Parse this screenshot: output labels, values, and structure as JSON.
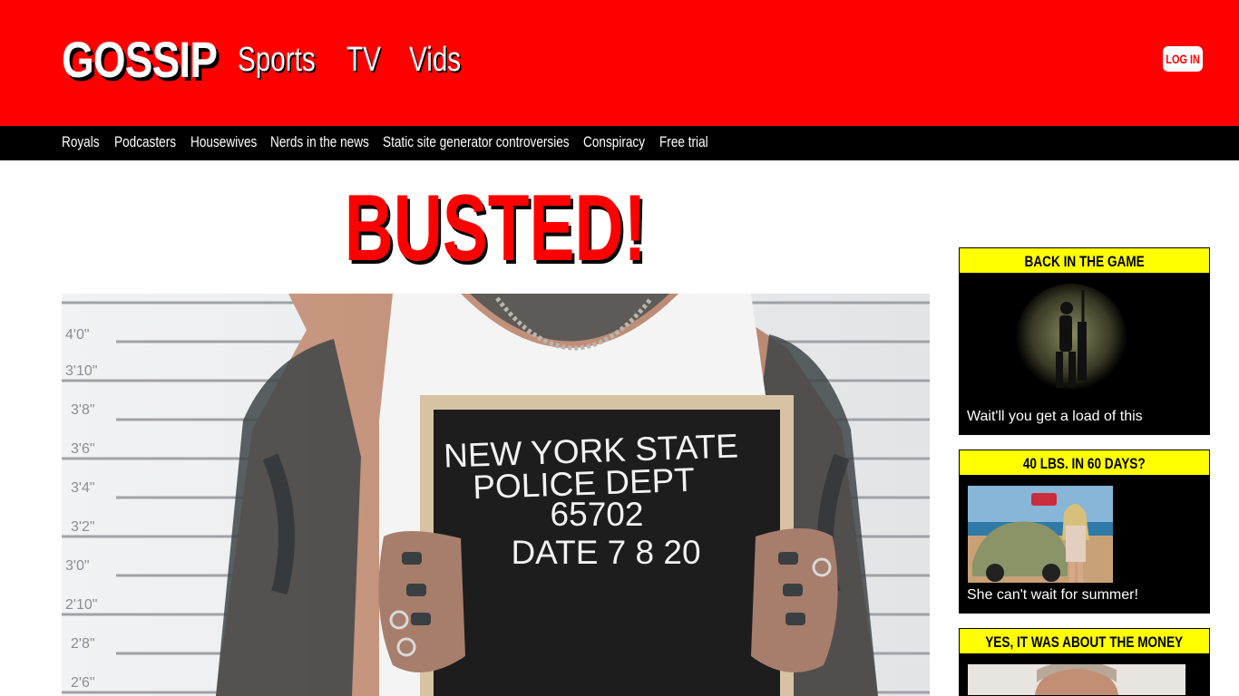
{
  "header": {
    "logo": "GOSSIP",
    "nav": [
      "Sports",
      "TV",
      "Vids"
    ],
    "login_label": "LOG IN"
  },
  "subnav": {
    "items": [
      "Royals",
      "Podcasters",
      "Housewives",
      "Nerds in the news",
      "Static site generator controversies",
      "Conspiracy",
      "Free trial"
    ]
  },
  "article": {
    "headline": "BUSTED!",
    "sign": {
      "line1": "NEW YORK STATE",
      "line2": "POLICE DEPT",
      "line3": "65702",
      "line4": "DATE 7 8 20"
    },
    "height_marks": [
      "4'0\"",
      "3'10\"",
      "3'8\"",
      "3'6\"",
      "3'4\"",
      "3'2\"",
      "3'0\"",
      "2'10\"",
      "2'8\"",
      "2'6\""
    ]
  },
  "sidebar": {
    "cards": [
      {
        "title": "BACK IN THE GAME",
        "caption": "Wait'll you get a load of this"
      },
      {
        "title": "40 LBS. IN 60 DAYS?",
        "caption": "She can't wait for summer!"
      },
      {
        "title": "YES, IT WAS ABOUT THE MONEY",
        "caption": ""
      }
    ]
  },
  "colors": {
    "brand_red": "#ff0000",
    "nav_black": "#000000",
    "card_title_yellow": "#ffff00"
  }
}
